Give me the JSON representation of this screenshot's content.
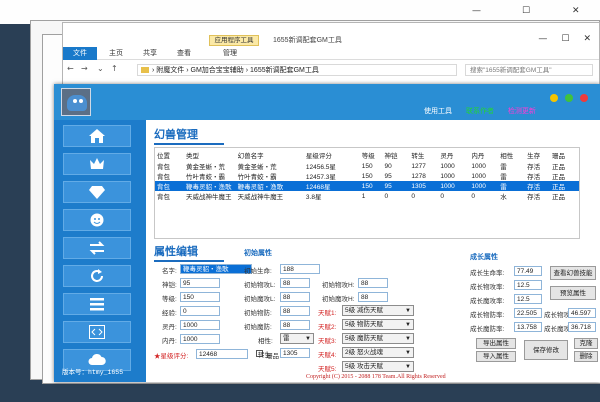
{
  "explorer": {
    "context_tab": "应用程序工具",
    "window_title": "1655新调配套GM工具",
    "ribbon_tabs": [
      "文件",
      "主页",
      "共享",
      "查看",
      "管理"
    ],
    "address": [
      "附魔文件",
      "GM加合宝宝辅助",
      "1655新调配套GM工具"
    ],
    "search_placeholder": "搜索\"1655新调配套GM工具\""
  },
  "app": {
    "header_links": [
      "使用工具",
      "联系作者",
      "检测更新"
    ],
    "header_link_colors": [
      "#ffffff",
      "#22d33a",
      "#ff3ad6"
    ],
    "window_dots": [
      "#f5c400",
      "#40c23c",
      "#ee3b3b"
    ],
    "version": "版本号：htmy_1655",
    "copyright": "Copyright (C) 2015 - 2088 178 Team.All Rights Reserved"
  },
  "sidebar": {
    "items": [
      "home-icon",
      "crown-icon",
      "diamond-icon",
      "face-icon",
      "transfer-icon",
      "refresh-icon",
      "list-icon",
      "code-icon",
      "cloud-icon"
    ]
  },
  "pets": {
    "title": "幻兽管理",
    "columns": [
      "位置",
      "类型",
      "幻兽名字",
      "星级评分",
      "等级",
      "神铠",
      "转生",
      "灵丹",
      "内丹",
      "相性",
      "生存",
      "珊品"
    ],
    "rows": [
      [
        "背包",
        "黄金圣蜥・荒",
        "黄金圣蜥・荒",
        "12456.5星",
        "150",
        "90",
        "1277",
        "1000",
        "1000",
        "雷",
        "存活",
        "正品"
      ],
      [
        "背包",
        "竹叶青蛟・霸",
        "竹叶青蛟・霸",
        "12457.3星",
        "150",
        "95",
        "1278",
        "1000",
        "1000",
        "雷",
        "存活",
        "正品"
      ],
      [
        "背包",
        "鞭毒灵貂・渔歌",
        "鞭毒灵貂・渔歌",
        "12468星",
        "150",
        "95",
        "1305",
        "1000",
        "1000",
        "雷",
        "存活",
        "正品"
      ],
      [
        "背包",
        "天威战神牛魔王",
        "天威战神牛魔王",
        "3.8星",
        "1",
        "0",
        "0",
        "0",
        "0",
        "水",
        "存活",
        "正品"
      ]
    ],
    "selected_row": 2
  },
  "attrs": {
    "title": "属性编辑",
    "name_label": "名字:",
    "name_value": "鞭毒灵貂・渔歌",
    "shenkai_label": "神铠:",
    "shenkai_value": "95",
    "level_label": "等级:",
    "level_value": "150",
    "exp_label": "经验:",
    "exp_value": "0",
    "lingdan_label": "灵丹:",
    "lingdan_value": "1000",
    "neidan_label": "内丹:",
    "neidan_value": "1000",
    "star_label": "★星级评分:",
    "star_value": "12468",
    "zhenpin_label": "珊品",
    "initial": {
      "title": "初始属性",
      "life_label": "初始生命:",
      "life_value": "188",
      "phys_l_label": "初始物攻L:",
      "phys_l_value": "88",
      "phys_h_label": "初始物攻H:",
      "phys_h_value": "88",
      "mag_l_label": "初始魔攻L:",
      "mag_l_value": "88",
      "mag_h_label": "初始魔攻H:",
      "mag_h_value": "88",
      "speed_label": "初始物防:",
      "speed_value": "88",
      "mdef_label": "初始魔防:",
      "mdef_value": "88",
      "element_label": "相性:",
      "element_value": "雷",
      "rebirth_label": "转生:",
      "rebirth_value": "1305"
    },
    "skills": [
      {
        "label": "天赋1:",
        "level": "5级",
        "name": "减伤天赋"
      },
      {
        "label": "天赋2:",
        "level": "5级",
        "name": "物防天赋"
      },
      {
        "label": "天赋3:",
        "level": "5级",
        "name": "魔防天赋"
      },
      {
        "label": "天赋4:",
        "level": "2级",
        "name": "怒火战魂"
      },
      {
        "label": "天赋5:",
        "level": "5级",
        "name": "攻击天赋"
      }
    ],
    "growth": {
      "title": "成长属性",
      "life_label": "成长生命率:",
      "life_value": "77.49",
      "phys_label": "成长物攻率:",
      "phys_value": "12.5",
      "mag_label": "成长魔攻率:",
      "mag_value": "12.5",
      "pdef_label": "成长物防率:",
      "pdef_value": "22.505",
      "mdef_label": "成长魔防率:",
      "mdef_value": "13.758",
      "atk_h_label": "成长物攻H:",
      "atk_h_value": "46.597",
      "matk_h_label": "成长魔攻H:",
      "matk_h_value": "36.718"
    },
    "buttons": {
      "view_skills": "查看幻兽技能",
      "preview": "预览属性",
      "export": "导出属性",
      "import": "导入属性",
      "save": "保存修改",
      "clone": "克隆",
      "delete": "删除"
    }
  }
}
